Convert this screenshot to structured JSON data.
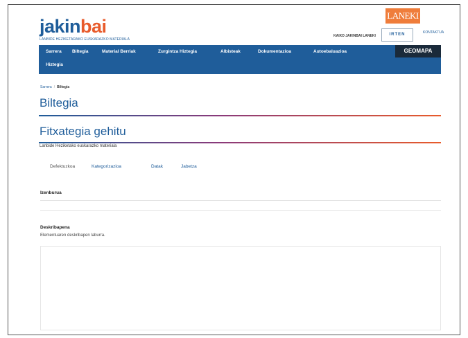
{
  "header": {
    "logo_part1": "jakin",
    "logo_part2": "bai",
    "logo_subtitle": "LANBIDE HEZIKETARAKO EUSKARAZKO MATERIALA",
    "partner_logo": "LANEKI",
    "user_label": "KAIXO JAKINBAI LANEKI",
    "logout_label": "IRTEN",
    "contact_label": "KONTAKTUA"
  },
  "nav": {
    "items": [
      "Sarrera",
      "Biltegia",
      "Material Berriak",
      "Zurgintza Hiztegia",
      "Albisteak",
      "Dokumentazioa",
      "Autoebaluazioa",
      "Hiztegia"
    ],
    "geomapa_label": "GEOMAPA"
  },
  "breadcrumb": {
    "home": "Sarrera",
    "current": "Biltegia"
  },
  "page": {
    "title": "Biltegia",
    "form_title": "Fitxategia gehitu",
    "subtitle": "Lanbide Heziketako euskarazko materiala"
  },
  "tabs": [
    "Defektuzkoa",
    "Kategorizazioa",
    "Datak",
    "Jabetza"
  ],
  "form": {
    "title_label": "Izenburua",
    "title_value": "",
    "description_label": "Deskribapena",
    "description_help": "Elementuaren deskribapen laburra.",
    "description_value": ""
  },
  "colors": {
    "brand_blue": "#1f5d9a",
    "brand_orange": "#e85b2b",
    "geomapa_bg": "#1a2a3a"
  }
}
